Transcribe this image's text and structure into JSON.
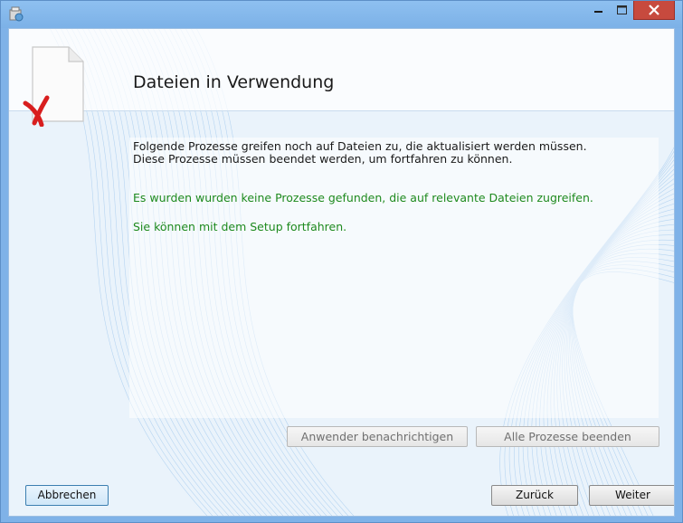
{
  "window": {
    "title": "",
    "controls": {
      "minimize": "minimize-icon",
      "maximize": "maximize-icon",
      "close": "close-icon"
    },
    "accent": "#7fb2e8",
    "close_color": "#c74a3e"
  },
  "header": {
    "icon": "file-in-use-icon",
    "title": "Dateien in Verwendung"
  },
  "main": {
    "description_line1": "Folgende Prozesse greifen noch auf Dateien zu, die aktualisiert werden müssen.",
    "description_line2": "Diese Prozesse müssen beendet werden, um fortfahren zu können.",
    "status_message": "Es wurden wurden keine Prozesse gefunden, die auf relevante Dateien zugreifen.",
    "continue_message": "Sie können mit dem Setup fortfahren.",
    "status_color": "#1e8a1e",
    "notify_button": "Anwender benachrichtigen",
    "end_all_button": "Alle Prozesse beenden"
  },
  "footer": {
    "cancel_button": "Abbrechen",
    "back_button": "Zurück",
    "next_button": "Weiter"
  }
}
